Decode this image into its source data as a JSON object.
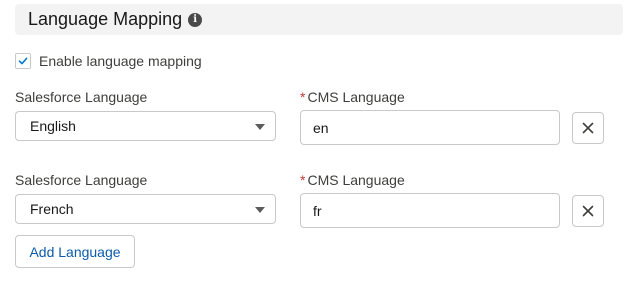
{
  "section": {
    "title": "Language Mapping",
    "info_icon": "info-icon"
  },
  "enable_mapping": {
    "label": "Enable language mapping",
    "checked": true
  },
  "mappings": [
    {
      "salesforce_label": "Salesforce Language",
      "salesforce_value": "English",
      "cms_required_mark": "*",
      "cms_label": "CMS Language",
      "cms_value": "en",
      "remove_icon": "close-icon"
    },
    {
      "salesforce_label": "Salesforce Language",
      "salesforce_value": "French",
      "cms_required_mark": "*",
      "cms_label": "CMS Language",
      "cms_value": "fr",
      "remove_icon": "close-icon"
    }
  ],
  "actions": {
    "add_language_label": "Add Language"
  },
  "colors": {
    "header_bg": "#f3f3f3",
    "required": "#c23934",
    "link": "#0b5cab",
    "check": "#0176d3",
    "border": "#c9c9c9"
  }
}
